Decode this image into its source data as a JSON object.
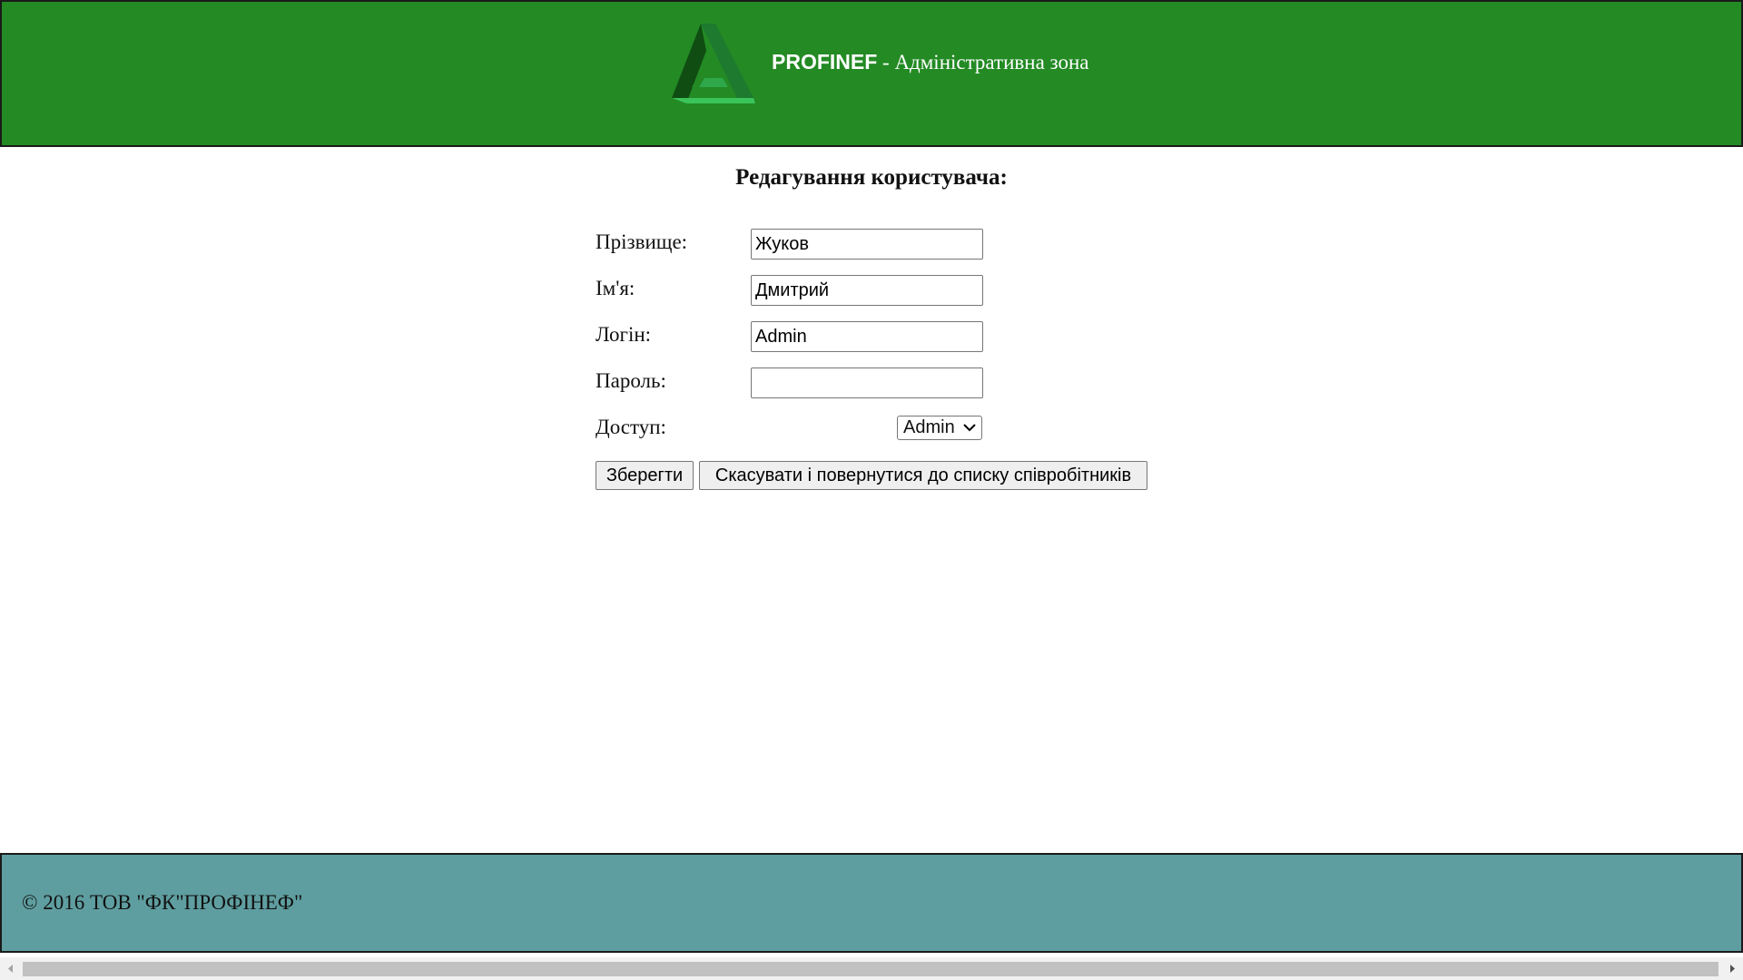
{
  "header": {
    "brand_name": "PROFINEF",
    "brand_subtitle": " - Адміністративна зона",
    "colors": {
      "background": "#238a24",
      "logo_dark": "#0f4d12",
      "logo_light": "#3bc45a"
    }
  },
  "page": {
    "title": "Редагування користувача:"
  },
  "form": {
    "surname": {
      "label": "Прізвище:",
      "value": "Жуков"
    },
    "first_name": {
      "label": "Ім'я:",
      "value": "Дмитрий"
    },
    "login": {
      "label": "Логін:",
      "value": "Admin"
    },
    "password": {
      "label": "Пароль:",
      "value": ""
    },
    "access": {
      "label": "Доступ:",
      "selected": "Admin"
    }
  },
  "actions": {
    "save_label": "Зберегти",
    "cancel_label": "Скасувати і повернутися до списку співробітників"
  },
  "footer": {
    "copyright": "© 2016 ТОВ \"ФК\"ПРОФІНЕФ\"",
    "background": "#5f9ea0"
  },
  "icons": {
    "logo": "profinef-triangle-logo",
    "select": "chevron-down-icon",
    "scroll_left": "arrow-left-icon",
    "scroll_right": "arrow-right-icon"
  }
}
